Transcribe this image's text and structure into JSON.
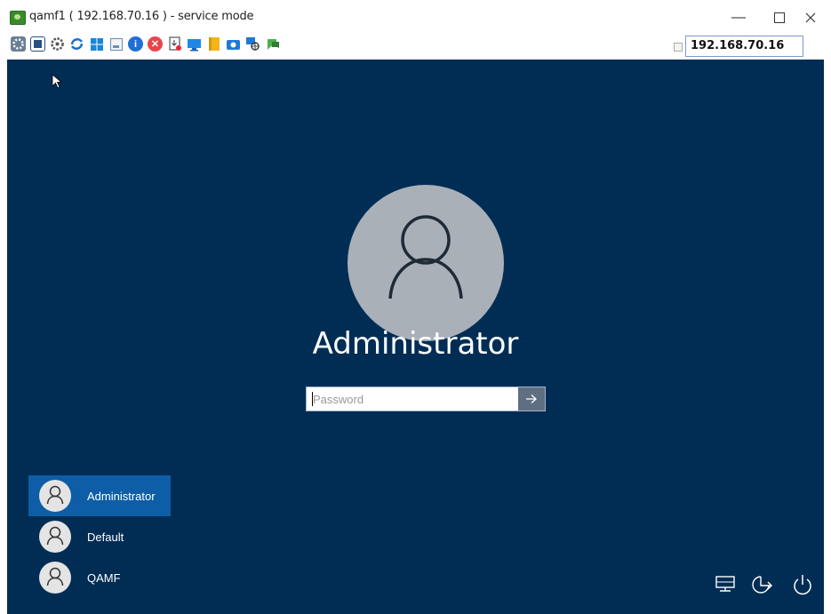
{
  "window": {
    "title": "qamf1 ( 192.168.70.16 ) - service mode",
    "minimize_glyph": "—",
    "maximize_glyph": "☐",
    "close_glyph": "✕"
  },
  "toolbar": {
    "icons": [
      "gears-icon",
      "fullscreen-icon",
      "settings-icon",
      "refresh-icon",
      "windows-icon",
      "terminal-icon",
      "info-icon",
      "stop-icon",
      "file-transfer-icon",
      "monitor-icon",
      "notes-icon",
      "camera-icon",
      "network-icon",
      "chat-icon"
    ],
    "ip_address": "192.168.70.16"
  },
  "login": {
    "user_name": "Administrator",
    "password_placeholder": "Password",
    "submit_glyph": "→"
  },
  "user_list": [
    {
      "name": "Administrator",
      "selected": true
    },
    {
      "name": "Default",
      "selected": false
    },
    {
      "name": "QAMF",
      "selected": false
    }
  ],
  "system_icons": [
    "network-status-icon",
    "ease-of-access-icon",
    "power-icon"
  ],
  "colors": {
    "screen_background": "#012d55",
    "selected_user": "#0d5ea6",
    "avatar_large": "#a9b0b8"
  }
}
